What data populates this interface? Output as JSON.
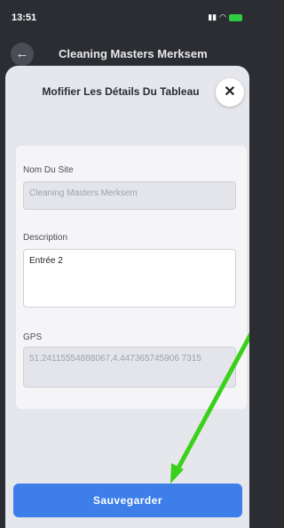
{
  "status_bar": {
    "time": "13:51",
    "signal_icon": "signal-icon",
    "wifi_icon": "wifi-icon",
    "battery_icon": "battery-charging-icon"
  },
  "header": {
    "back_icon": "arrow-left-icon",
    "title": "Cleaning Masters Merksem"
  },
  "modal": {
    "title": "Mofifier Les Détails Du Tableau",
    "close_icon": "close-icon",
    "fields": {
      "site_name": {
        "label": "Nom Du Site",
        "value": "Cleaning Masters Merksem"
      },
      "description": {
        "label": "Description",
        "value": "Entrée 2"
      },
      "gps": {
        "label": "GPS",
        "value": "51.24115554888067,4.447365745906 7315"
      }
    },
    "save_label": "Sauvegarder"
  },
  "colors": {
    "primary": "#3d7ee8",
    "annotation_arrow": "#39d11a",
    "battery": "#2ecc40"
  }
}
